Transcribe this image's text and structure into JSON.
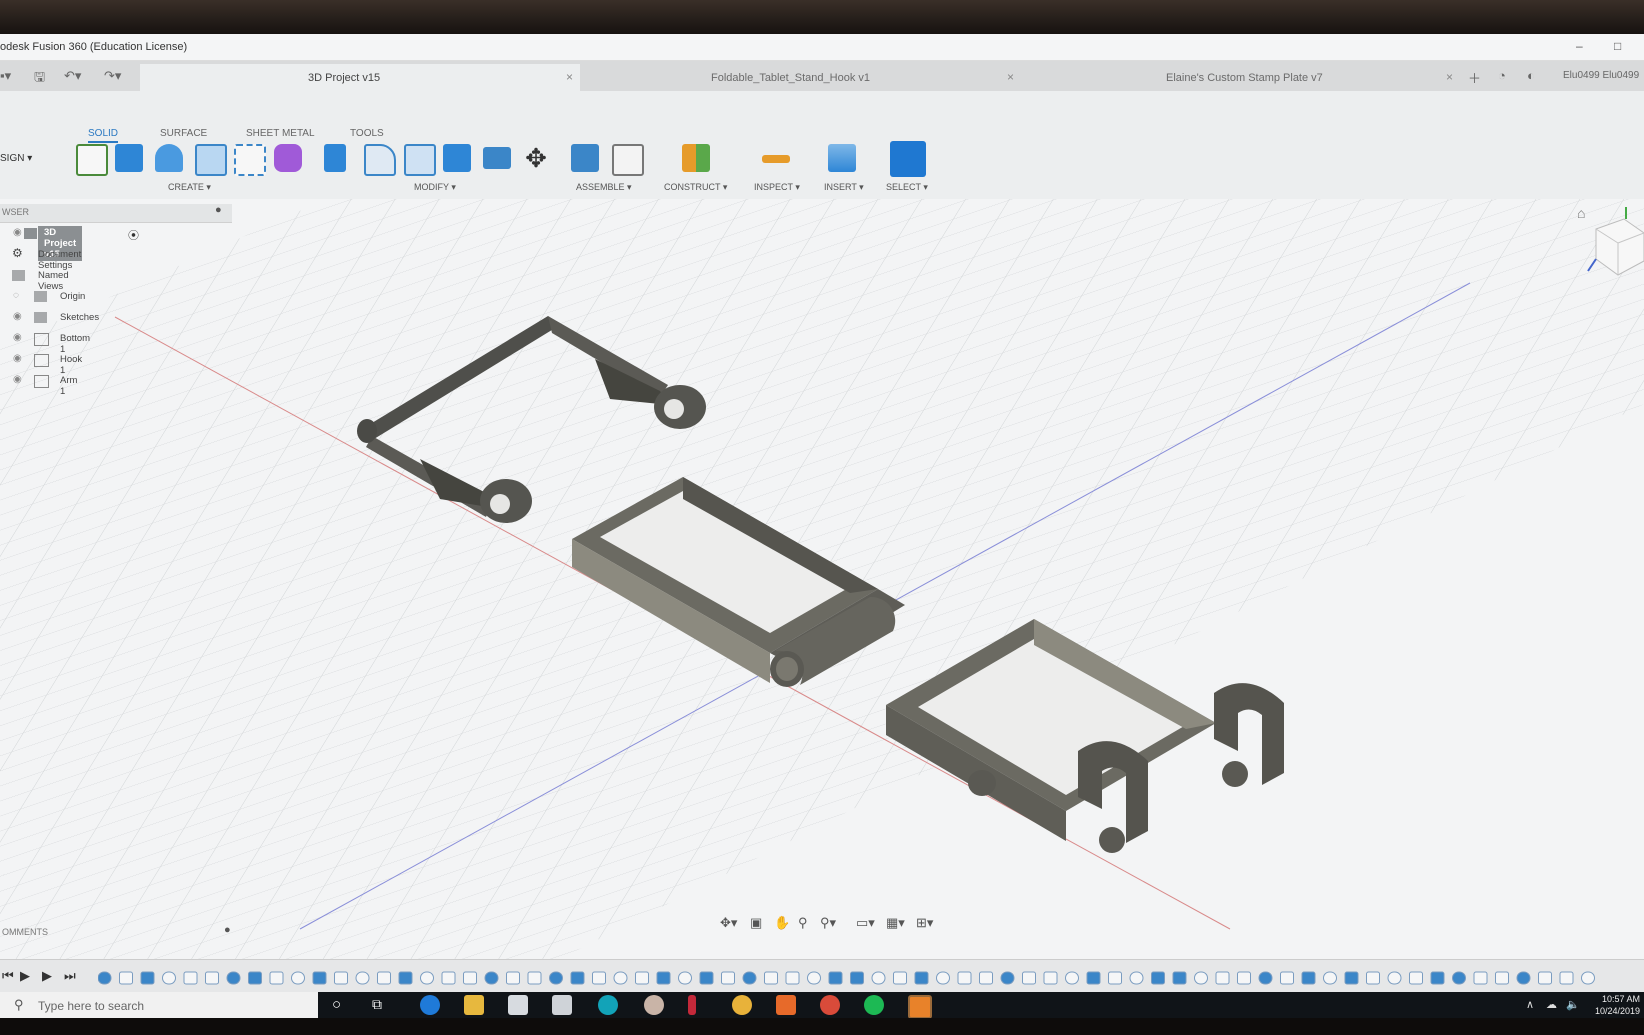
{
  "window": {
    "title": "odesk Fusion 360 (Education License)",
    "minimize": "–",
    "maximize": "□"
  },
  "tabs": [
    {
      "label": "3D Project v15",
      "close": "×"
    },
    {
      "label": "Foldable_Tablet_Stand_Hook v1",
      "close": "×"
    },
    {
      "label": "Elaine's Custom Stamp Plate v7",
      "close": "×"
    }
  ],
  "account": {
    "user": "Elu0499 Elu0499"
  },
  "toolbar": {
    "workspace": "SIGN ▾",
    "mode_tabs": [
      "SOLID",
      "SURFACE",
      "SHEET METAL",
      "TOOLS"
    ],
    "groups": {
      "create": "CREATE ▾",
      "modify": "MODIFY ▾",
      "assemble": "ASSEMBLE ▾",
      "construct": "CONSTRUCT ▾",
      "inspect": "INSPECT ▾",
      "insert": "INSERT ▾",
      "select": "SELECT ▾"
    }
  },
  "browser": {
    "title": "WSER",
    "nodes": [
      {
        "label": "3D Project v15"
      },
      {
        "label": "Document Settings"
      },
      {
        "label": "Named Views"
      },
      {
        "label": "Origin"
      },
      {
        "label": "Sketches"
      },
      {
        "label": "Bottom 1"
      },
      {
        "label": "Hook 1"
      },
      {
        "label": "Arm 1"
      }
    ]
  },
  "comments": {
    "title": "OMMENTS"
  },
  "search": {
    "placeholder": "Type here to search"
  },
  "clock": {
    "time": "10:57 AM",
    "date": "10/24/2019"
  },
  "colors": {
    "accent": "#2b79c2",
    "model_dark": "#4f4f4b",
    "model_mid": "#6b6a62",
    "model_light": "#8c8a7f",
    "grid_line": "#d3d6d8",
    "axis_x": "#d98a8a",
    "axis_z": "#8a8fd9"
  }
}
